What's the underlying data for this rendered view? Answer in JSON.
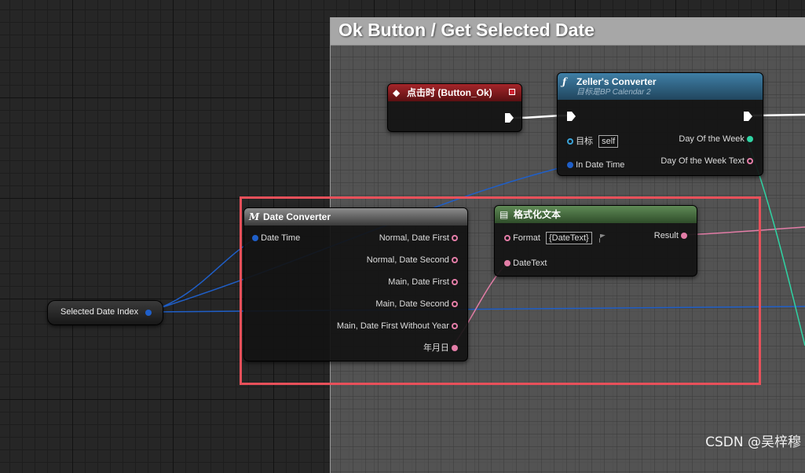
{
  "comment": {
    "title": "Ok Button / Get Selected Date"
  },
  "event_node": {
    "title": "点击时 (Button_Ok)"
  },
  "zeller_node": {
    "title": "Zeller's Converter",
    "subtitle": "目标是BP Calendar 2",
    "pins": {
      "target_label": "目标",
      "target_value": "self",
      "in_date_time": "In Date Time",
      "day_of_week": "Day Of the Week",
      "day_of_week_text": "Day Of the Week Text"
    }
  },
  "date_converter_node": {
    "title": "Date Converter",
    "input": "Date Time",
    "outputs": [
      "Normal, Date First",
      "Normal, Date Second",
      "Main, Date First",
      "Main, Date Second",
      "Main, Date First Without Year",
      "年月日"
    ]
  },
  "format_node": {
    "title": "格式化文本",
    "format_label": "Format",
    "format_value": "{DateText}",
    "result_label": "Result",
    "date_text_label": "DateText"
  },
  "variable_node": {
    "label": "Selected Date Index"
  },
  "watermark": "CSDN @吴梓穆",
  "colors": {
    "highlight": "#e8505a",
    "event_header": "#a5262a",
    "function_header": "#3f7fa6",
    "format_header": "#5f8a56",
    "struct_pin": "#1f5fc9",
    "text_pin": "#e37da7",
    "enum_pin": "#2fd3a3"
  }
}
